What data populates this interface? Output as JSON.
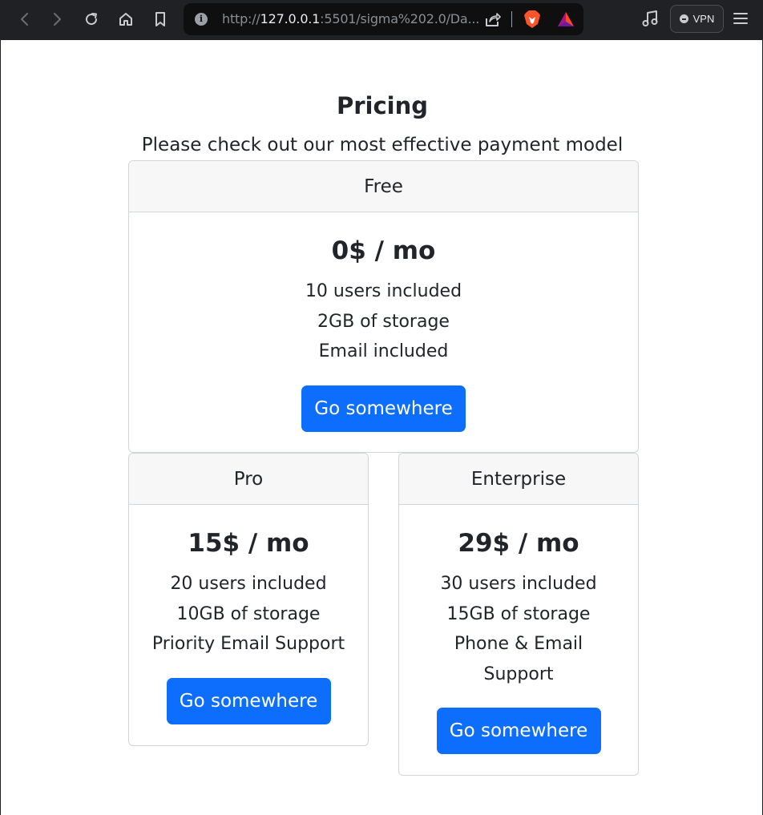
{
  "browser": {
    "url_prefix": "http://",
    "url_host": "127.0.0.1",
    "url_rest": ":5501/sigma%202.0/Da...",
    "vpn_label": "VPN",
    "icons": [
      "back-icon",
      "forward-icon",
      "reload-icon",
      "home-icon",
      "bookmark-icon",
      "info-icon",
      "share-icon",
      "brave-shield-icon",
      "brave-rewards-icon",
      "music-icon",
      "vpn-icon",
      "menu-icon"
    ]
  },
  "pricing": {
    "title": "Pricing",
    "subtitle": "Please check out our most effective payment model",
    "plans": [
      {
        "name": "Free",
        "price": "0$ / mo",
        "features": [
          "10 users included",
          "2GB of storage",
          "Email included"
        ],
        "button": "Go somewhere"
      },
      {
        "name": "Pro",
        "price": "15$ / mo",
        "features": [
          "20 users included",
          "10GB of storage",
          "Priority Email Support"
        ],
        "button": "Go somewhere"
      },
      {
        "name": "Enterprise",
        "price": "29$ / mo",
        "features": [
          "30 users included",
          "15GB of storage",
          "Phone & Email",
          "Support"
        ],
        "button": "Go somewhere"
      }
    ]
  },
  "colors": {
    "accent": "#0d6efd",
    "chrome": "#202124",
    "text": "#212529"
  }
}
